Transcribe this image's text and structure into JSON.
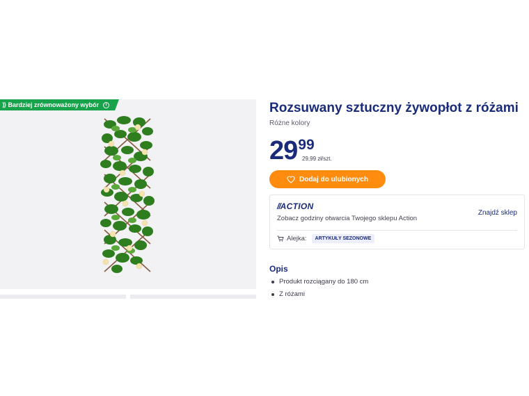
{
  "badge": {
    "label": "Bardziej zrównoważony wybór",
    "info_icon": "info-icon",
    "leaf_icon": "sustainable-icon"
  },
  "product": {
    "title": "Rozsuwany sztuczny żywopłot z różami",
    "subtitle": "Różne kolory",
    "price_int": "29",
    "price_dec": "99",
    "unit_price": "29,99 zł/szt.",
    "image_icon": "artificial-hedge-with-roses-image"
  },
  "favorite_button": {
    "label": "Dodaj do ulubionych",
    "icon": "heart-icon"
  },
  "store": {
    "logo_text": "ACTION",
    "hours_text": "Zobacz godziny otwarcia Twojego sklepu Action",
    "find_store": "Znajdź sklep",
    "aisle_label": "Alejka:",
    "aisle_value": "ARTYKUŁY SEZONOWE",
    "cart_icon": "cart-icon"
  },
  "description": {
    "heading": "Opis",
    "items": [
      "Produkt rozciągany do 180 cm",
      "Z różami"
    ]
  },
  "colors": {
    "brand_blue": "#1a2b7a",
    "accent_orange": "#ff8c0f",
    "eco_green": "#16a34a"
  }
}
